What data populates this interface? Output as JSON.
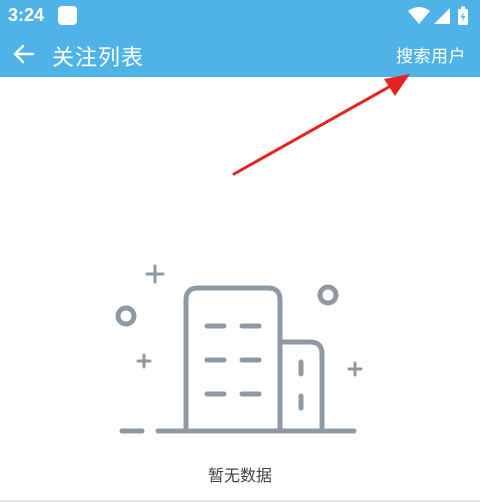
{
  "status_bar": {
    "time": "3:24"
  },
  "toolbar": {
    "title": "关注列表",
    "search_user_label": "搜索用户"
  },
  "empty_state": {
    "message": "暂无数据"
  },
  "colors": {
    "primary": "#4fb3e8",
    "illustration": "#8e99a3",
    "annotation_arrow": "#e52420"
  },
  "icons": {
    "back": "arrow-left-icon",
    "wifi": "wifi-icon",
    "signal": "cellular-signal-icon",
    "battery": "battery-charging-icon",
    "empty": "empty-building-icon"
  }
}
